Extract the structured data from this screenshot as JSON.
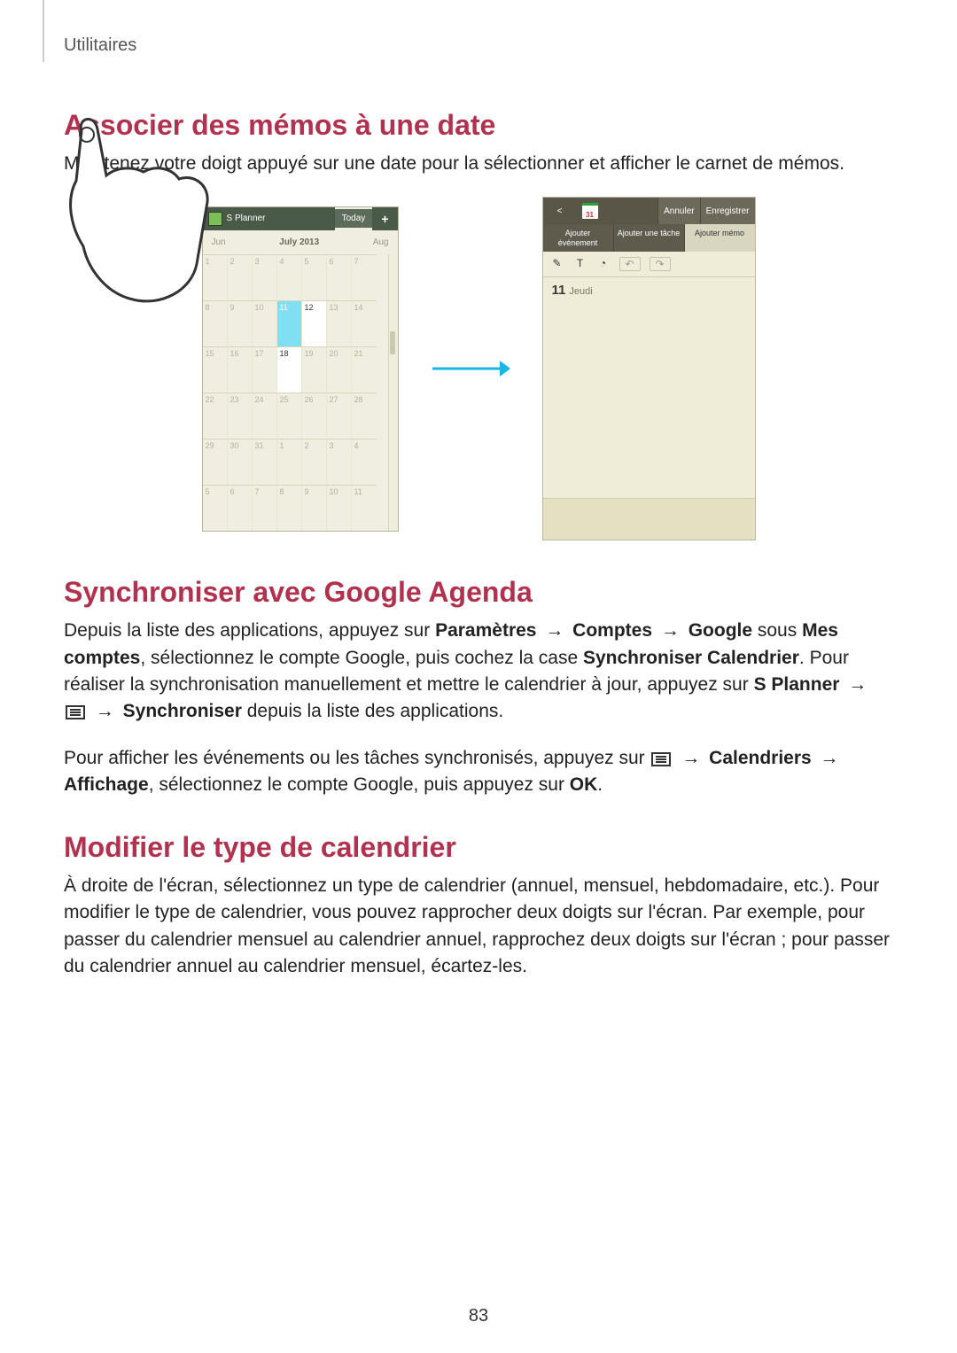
{
  "page": {
    "running_head": "Utilitaires",
    "number": "83"
  },
  "sec1": {
    "title": "Associer des mémos à une date",
    "p1": "Maintenez votre doigt appuyé sur une date pour la sélectionner et afficher le carnet de mémos."
  },
  "calendar": {
    "app_name": "S Planner",
    "today": "Today",
    "add": "+",
    "month_prev": "Jun",
    "month_mid_label": "July",
    "month_mid_year": "2013",
    "month_next": "Aug",
    "rows": [
      [
        "1",
        "2",
        "3",
        "4",
        "5",
        "6",
        "7"
      ],
      [
        "8",
        "9",
        "10",
        "11",
        "12",
        "13",
        "14"
      ],
      [
        "15",
        "16",
        "17",
        "18",
        "19",
        "20",
        "21"
      ],
      [
        "22",
        "23",
        "24",
        "25",
        "26",
        "27",
        "28"
      ],
      [
        "29",
        "30",
        "31",
        "1",
        "2",
        "3",
        "4"
      ],
      [
        "5",
        "6",
        "7",
        "8",
        "9",
        "10",
        "11"
      ]
    ],
    "touch_cell": "11",
    "after_cells": [
      "12",
      "18"
    ]
  },
  "memo": {
    "back": "<",
    "cal_badge": "31",
    "annuler": "Annuler",
    "enregistrer": "Enregistrer",
    "tab_event": "Ajouter événement",
    "tab_task": "Ajouter une tâche",
    "tab_memo": "Ajouter mémo",
    "tool_pen": "✎",
    "tool_text": "T",
    "tool_eraser": "◔",
    "tool_undo": "↶",
    "tool_redo": "↷",
    "date_num": "11",
    "date_day": "Jeudi"
  },
  "sec2": {
    "title": "Synchroniser avec Google Agenda",
    "p1_a": "Depuis la liste des applications, appuyez sur ",
    "b_param": "Paramètres",
    "arrow": " → ",
    "b_comptes": "Comptes",
    "b_google": "Google",
    "p1_b": " sous ",
    "b_mescomptes": "Mes comptes",
    "p1_c": ", sélectionnez le compte Google, puis cochez la case ",
    "b_sync_cal": "Synchroniser Calendrier",
    "p1_d": ". Pour réaliser la synchronisation manuellement et mettre le calendrier à jour, appuyez sur ",
    "b_splanner": "S Planner",
    "p1_e": " ",
    "b_sync": "Synchroniser",
    "p1_f": " depuis la liste des applications.",
    "p2_a": "Pour afficher les événements ou les tâches synchronisés, appuyez sur ",
    "b_calendriers": "Calendriers",
    "b_affichage": "Affichage",
    "p2_b": ", sélectionnez le compte Google, puis appuyez sur ",
    "b_ok": "OK",
    "dot": "."
  },
  "sec3": {
    "title": "Modifier le type de calendrier",
    "p1": "À droite de l'écran, sélectionnez un type de calendrier (annuel, mensuel, hebdomadaire, etc.). Pour modifier le type de calendrier, vous pouvez rapprocher deux doigts sur l'écran. Par exemple, pour passer du calendrier mensuel au calendrier annuel, rapprochez deux doigts sur l'écran ; pour passer du calendrier annuel au calendrier mensuel, écartez-les."
  }
}
